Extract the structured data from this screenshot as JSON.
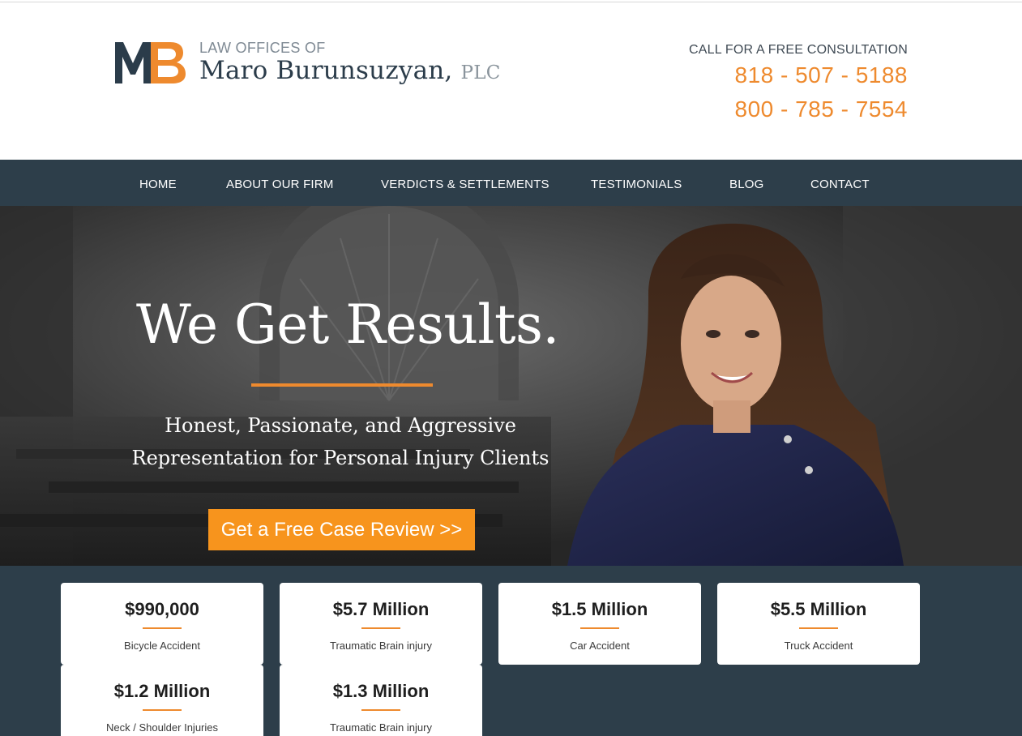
{
  "header": {
    "logo_small": "LAW OFFICES OF",
    "logo_name": "Maro Burunsuzyan,",
    "logo_suffix": "PLC",
    "call_label": "CALL FOR A FREE CONSULTATION",
    "phone_1": "818 - 507 - 5188",
    "phone_2": "800 - 785 - 7554",
    "brand_colors": {
      "accent": "#ee8a2e",
      "dark": "#2d3e4a"
    }
  },
  "nav": {
    "items": [
      {
        "label": "HOME"
      },
      {
        "label": "ABOUT OUR FIRM"
      },
      {
        "label": "VERDICTS & SETTLEMENTS"
      },
      {
        "label": "TESTIMONIALS"
      },
      {
        "label": "BLOG"
      },
      {
        "label": "CONTACT"
      }
    ]
  },
  "hero": {
    "title": "We Get Results.",
    "subtitle_line1": "Honest, Passionate, and Aggressive",
    "subtitle_line2": "Representation for Personal Injury Clients",
    "cta_label": "Get a Free Case Review >>"
  },
  "results": {
    "cards": [
      {
        "amount": "$990,000",
        "label": "Bicycle Accident"
      },
      {
        "amount": "$5.7 Million",
        "label": "Traumatic Brain injury"
      },
      {
        "amount": "$1.5 Million",
        "label": "Car Accident"
      },
      {
        "amount": "$5.5 Million",
        "label": "Truck Accident"
      },
      {
        "amount": "$1.2 Million",
        "label": "Neck / Shoulder Injuries"
      },
      {
        "amount": "$1.3 Million",
        "label": "Traumatic Brain injury"
      }
    ]
  }
}
